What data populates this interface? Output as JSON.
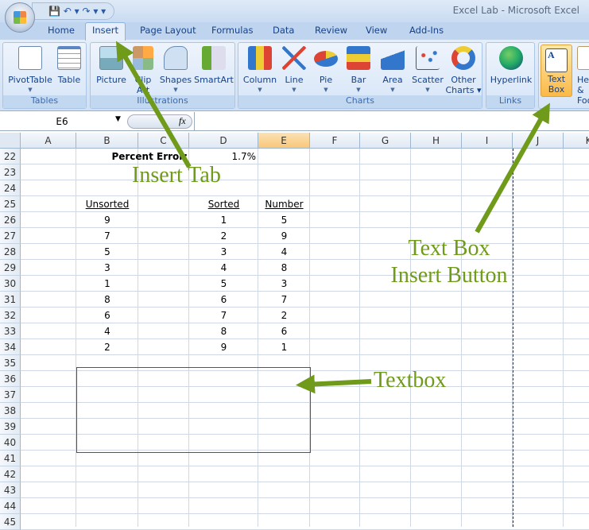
{
  "window": {
    "title": "Excel Lab  -  Microsoft Excel",
    "qat": "💾 ↶ ▾ ↷ ▾   ▾"
  },
  "tabs": [
    "Home",
    "Insert",
    "Page Layout",
    "Formulas",
    "Data",
    "Review",
    "View",
    "Add-Ins"
  ],
  "ribbon": {
    "groups": [
      {
        "label": "Tables",
        "buttons": [
          "PivotTable",
          "Table"
        ]
      },
      {
        "label": "Illustrations",
        "buttons": [
          "Picture",
          "Clip Art",
          "Shapes",
          "SmartArt"
        ]
      },
      {
        "label": "Charts",
        "buttons": [
          "Column",
          "Line",
          "Pie",
          "Bar",
          "Area",
          "Scatter",
          "Other Charts"
        ]
      },
      {
        "label": "Links",
        "buttons": [
          "Hyperlink"
        ]
      },
      {
        "label": "",
        "buttons": [
          "Text Box",
          "Header & Footer"
        ]
      }
    ]
  },
  "formula_bar": {
    "name_box": "E6",
    "fx": "fx",
    "value": ""
  },
  "columns": [
    "A",
    "B",
    "C",
    "D",
    "E",
    "F",
    "G",
    "H",
    "I",
    "J",
    "K"
  ],
  "selected_column": "E",
  "rows": [
    22,
    23,
    24,
    25,
    26,
    27,
    28,
    29,
    30,
    31,
    32,
    33,
    34,
    35,
    36,
    37,
    38,
    39,
    40,
    41,
    42,
    43,
    44,
    45
  ],
  "cells": {
    "percent_error_label": "Percent Error:",
    "percent_error_value": "1.7%",
    "headers": {
      "unsorted": "Unsorted",
      "sorted": "Sorted",
      "number": "Number"
    },
    "unsorted": [
      "9",
      "7",
      "5",
      "3",
      "1",
      "8",
      "6",
      "4",
      "2"
    ],
    "sorted": [
      "1",
      "2",
      "3",
      "4",
      "5",
      "6",
      "7",
      "8",
      "9"
    ],
    "number": [
      "5",
      "9",
      "4",
      "8",
      "3",
      "7",
      "2",
      "6",
      "1"
    ]
  },
  "annotations": {
    "insert_tab": "Insert Tab",
    "text_box_1": "Text Box",
    "text_box_2": "Insert Button",
    "textbox": "Textbox"
  },
  "colors": {
    "annotation": "#6f9a1a",
    "ribbon": "#cfe0f5",
    "highlight": "#fbb948"
  }
}
